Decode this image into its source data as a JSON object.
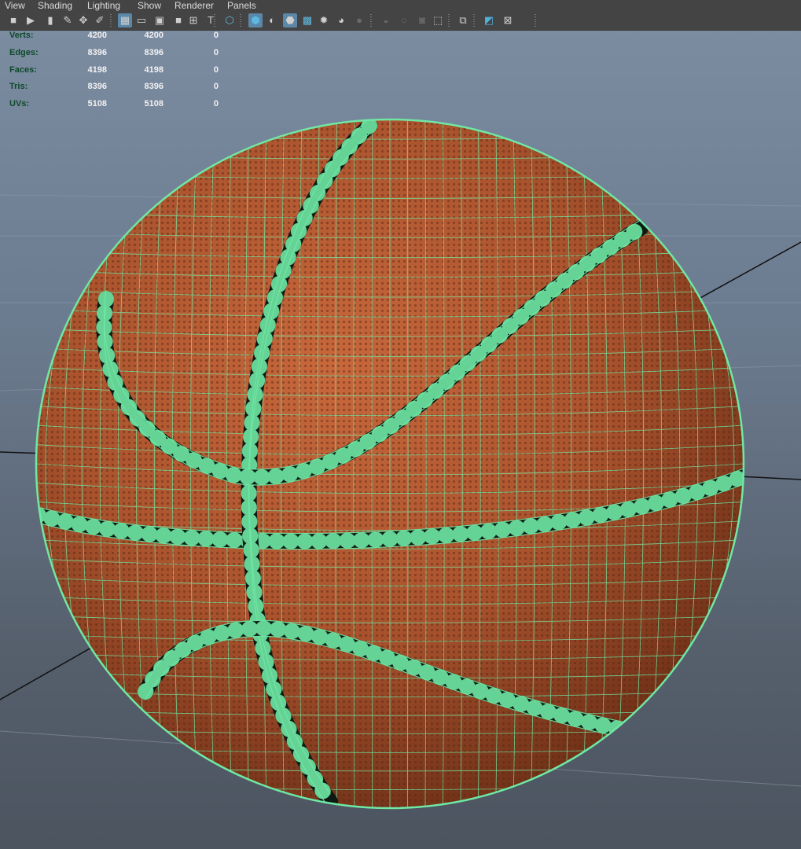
{
  "menu": {
    "items": [
      "View",
      "Shading",
      "Lighting",
      "Show",
      "Renderer",
      "Panels"
    ]
  },
  "toolbar": {
    "icons": [
      "camera-icon",
      "video-camera-icon",
      "bookmark-icon",
      "pen-icon",
      "move-icon",
      "brush-icon",
      "grid-icon",
      "film-gate-icon",
      "resolution-gate-icon",
      "gate-mask-icon",
      "field-chart-icon",
      "safe-title-icon",
      "wireframe-icon",
      "smooth-shade-icon",
      "shade-lit-icon",
      "wireframe-on-shaded-icon",
      "textured-icon",
      "light-icon",
      "shadow-icon",
      "screen-space-ao-icon",
      "motion-blur-icon",
      "anti-alias-icon",
      "depth-of-field-icon",
      "select-camera-icon",
      "isolate-select-icon",
      "xray-icon",
      "xray-joints-icon"
    ],
    "active": [
      "grid-icon",
      "smooth-shade-icon",
      "wireframe-on-shaded-icon"
    ]
  },
  "hud": {
    "rows": [
      {
        "label": "Verts:",
        "values": [
          "4200",
          "4200",
          "0"
        ]
      },
      {
        "label": "Edges:",
        "values": [
          "8396",
          "8396",
          "0"
        ]
      },
      {
        "label": "Faces:",
        "values": [
          "4198",
          "4198",
          "0"
        ]
      },
      {
        "label": "Tris:",
        "values": [
          "8396",
          "8396",
          "0"
        ]
      },
      {
        "label": "UVs:",
        "values": [
          "5108",
          "5108",
          "0"
        ]
      }
    ]
  },
  "scene": {
    "object": "basketball",
    "wire_color": "#6fe8a4",
    "ball_color": "#b85a32",
    "seam_color": "#0d1a14",
    "background_top": "#7b8ba0",
    "background_bottom": "#4b545f"
  }
}
